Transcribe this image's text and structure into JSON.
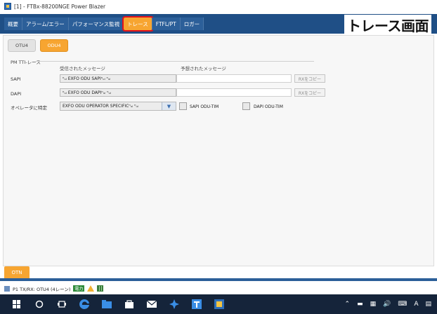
{
  "window": {
    "title": "[1] - FTBx-88200NGE Power Blazer"
  },
  "annotation": {
    "text": "トレース画面"
  },
  "tabs": [
    {
      "label": "概要"
    },
    {
      "label": "アラーム/エラー"
    },
    {
      "label": "パフォーマンス監視"
    },
    {
      "label": "トレース",
      "active": true
    },
    {
      "label": "FTFL/PT"
    },
    {
      "label": "ロガー"
    }
  ],
  "subtabs": [
    {
      "label": "OTU4"
    },
    {
      "label": "ODU4",
      "active": true
    }
  ],
  "panel": {
    "group_title": "PM TTI-レース",
    "col_received": "受信されたメッセージ",
    "col_expected": "予想されたメッセージ",
    "rows": [
      {
        "label": "SAPI",
        "received": "ⁿᵤₗ EXFO ODU SAPIⁿᵤₗ ⁿᵤₗ",
        "expected": "",
        "copy": "RXをコピー"
      },
      {
        "label": "DAPI",
        "received": "ⁿᵤₗ EXFO ODU DAPIⁿᵤₗ ⁿᵤₗ",
        "expected": "",
        "copy": "RXをコピー"
      }
    ],
    "operator_label": "オペレータに特定",
    "operator_value": "EXFO ODU OPERATOR SPECIFICⁿᵤₗ ⁿᵤₗ",
    "sapi_tim": "SAPI ODU-TIM",
    "dapi_tim": "DAPI ODU-TIM"
  },
  "bottom_tab": {
    "label": "OTN"
  },
  "statusbar": {
    "text": "P1 TX/RX: OTU4 (4レーン)",
    "badge": "電力"
  },
  "colors": {
    "tabbar": "#1f4f86",
    "accent": "#f7a531",
    "highlight": "#e3121a"
  }
}
